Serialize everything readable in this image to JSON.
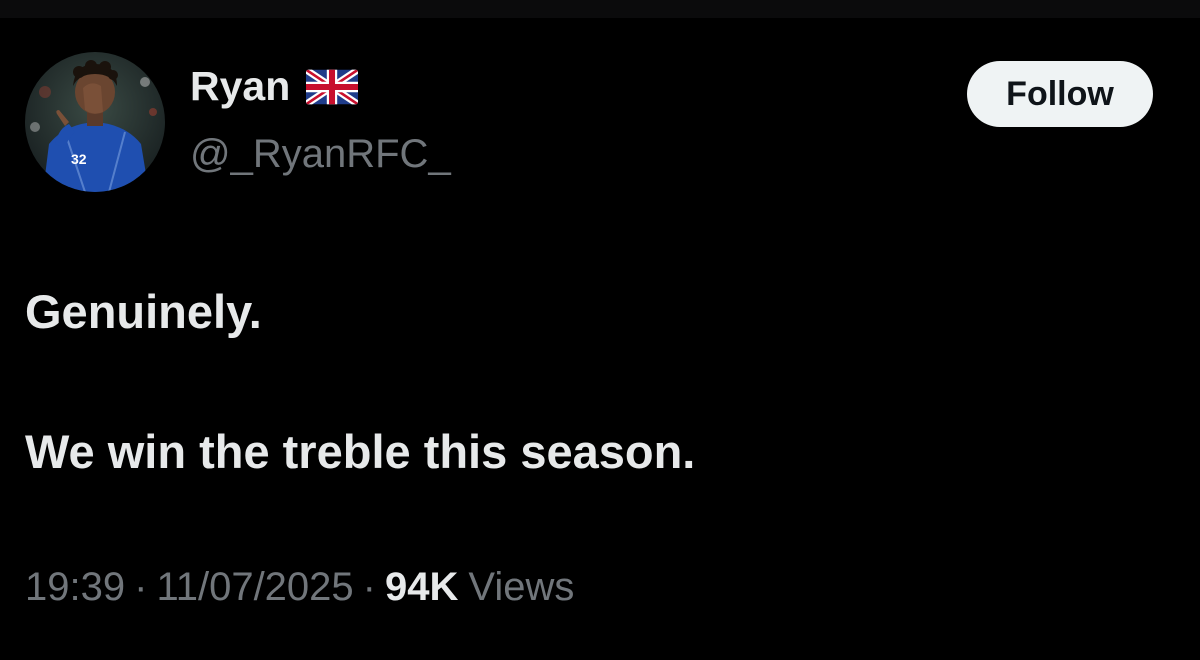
{
  "author": {
    "display_name": "Ryan",
    "flag_icon": "uk-flag-icon",
    "handle": "@_RyanRFC_",
    "avatar_icon": "footballer-avatar",
    "avatar_shirt_text": "32"
  },
  "actions": {
    "follow_label": "Follow"
  },
  "tweet": {
    "line_1": "Genuinely.",
    "line_2": "We win the treble this season."
  },
  "meta": {
    "time": "19:39",
    "separator": "·",
    "date": "11/07/2025",
    "view_count": "94K",
    "views_label": "Views"
  },
  "colors": {
    "background": "#000000",
    "primary_text": "#e7e9ea",
    "secondary_text": "#71767b",
    "follow_bg": "#eff3f4",
    "follow_text": "#0f1419"
  }
}
